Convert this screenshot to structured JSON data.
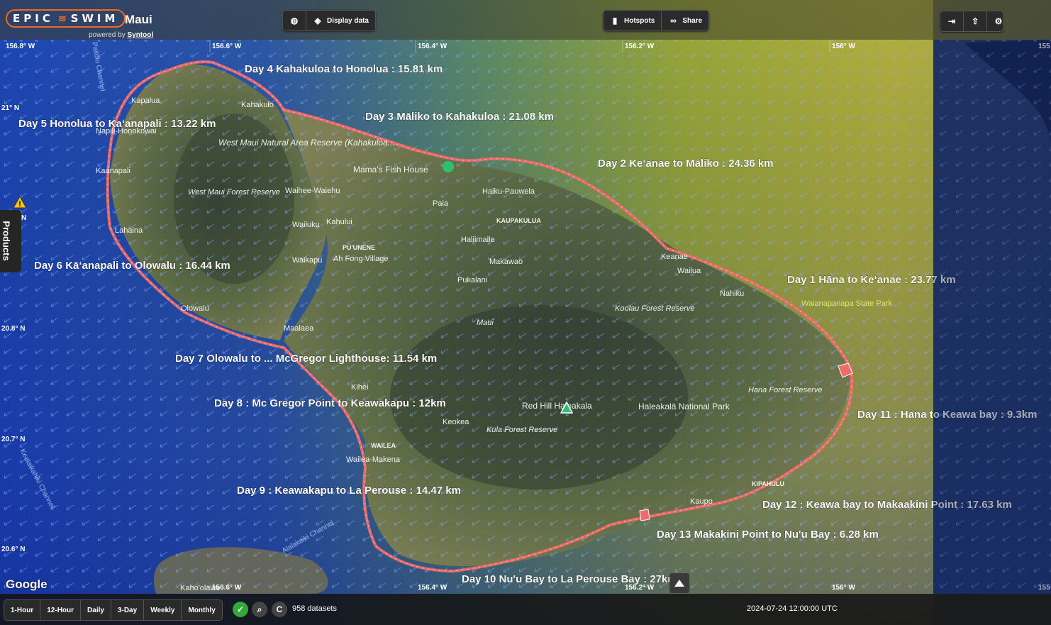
{
  "app": {
    "brand": "EPIC SWIM",
    "brand_left": "EPIC",
    "brand_right": "SWIM",
    "title": "Maui",
    "powered_prefix": "powered by",
    "powered_link": "Syntool"
  },
  "toolbar": {
    "display_data": "Display data",
    "hotspots": "Hotspots",
    "share": "Share"
  },
  "side": {
    "products_label": "Products"
  },
  "map": {
    "longitudes_top": [
      "156.8° W",
      "156.6° W",
      "156.4° W",
      "156.2° W",
      "156° W",
      "155"
    ],
    "longitudes_bottom": [
      "156.6° W",
      "156.4° W",
      "156.2° W",
      "156° W",
      "155"
    ],
    "latitudes": [
      "21° N",
      "20.8° N",
      "20.7° N",
      "20.6° N"
    ],
    "latitude_partial": "N",
    "route_labels": [
      "Day 1 Hāna to Keʻanae : 23.77 km",
      "Day 2 Keʻanae to Māliko : 24.36 km",
      "Day 3 Māliko to Kahakuloa : 21.08 km",
      "Day 4 Kahakuloa to Honolua : 15.81 km",
      "Day 5 Honolua to Kaʻanapali : 13.22 km",
      "Day 6 Kāʻanapali to Olowalu : 16.44 km",
      "Day 7 Olowalu to ... McGregor Lighthouse: 11.54 km",
      "Day 8 : Mc Gregor Point to Keawakapu : 12km",
      "Day 9 : Keawakapu to La Perouse : 14.47 km",
      "Day 10 Nu'u Bay to La Perouse Bay : 27km",
      "Day 11 : Hana to Keawa bay : 9.3km",
      "Day 12 : Keawa bay to Makaakini Point : 17.63 km",
      "Day 13 Makakini Point to Nu'u Bay : 6.28 km"
    ],
    "places": [
      "Kahakulo",
      "Kapalua",
      "Napili-Honokowai",
      "Kaanapali",
      "Lahaina",
      "Olowalu",
      "West Maui Natural Area Reserve (Kahakuloa...",
      "West Maui Forest Reserve",
      "Mama's Fish House",
      "Haiku-Pauwela",
      "Paia",
      "Waihee-Waiehu",
      "Wailuku",
      "Kahului",
      "KAUPAKULUA",
      "PU'UNENE",
      "Haliimaile",
      "Makawao",
      "Waikapu",
      "Ah Fong Village",
      "Pukalani",
      "Maui",
      "Keanae",
      "Wailua",
      "Nahiku",
      "Waianapanapa State Park",
      "Koolau Forest Reserve",
      "Maalaea",
      "Kihei",
      "Red Hill Haleakala",
      "Haleakalā National Park",
      "Hana Forest Reserve",
      "Keokea",
      "Kula Forest Reserve",
      "WAILEA",
      "Wailea-Makena",
      "KIPAHULU",
      "Kaupo",
      "Kaho'olawe",
      "Pailolo Channel",
      "Alalakeiki Channel",
      "Kealaikahiki Channel"
    ],
    "attribution": "Google"
  },
  "bottom": {
    "tabs": [
      "1-Hour",
      "12-Hour",
      "Daily",
      "3-Day",
      "Weekly",
      "Monthly"
    ],
    "datasets": "958 datasets",
    "timestamp": "2024-07-24 12:00:00 UTC",
    "c_label": "C"
  },
  "colors": {
    "route": "#f06a6a",
    "accent": "#e86a24",
    "ocean": "#1b3ea8"
  },
  "icons": [
    "globe-icon",
    "layers-icon",
    "bookmark-icon",
    "link-icon",
    "login-icon",
    "upload-icon",
    "settings-icon",
    "check-icon",
    "zoom-icon",
    "warning-icon",
    "caret-up-icon"
  ]
}
